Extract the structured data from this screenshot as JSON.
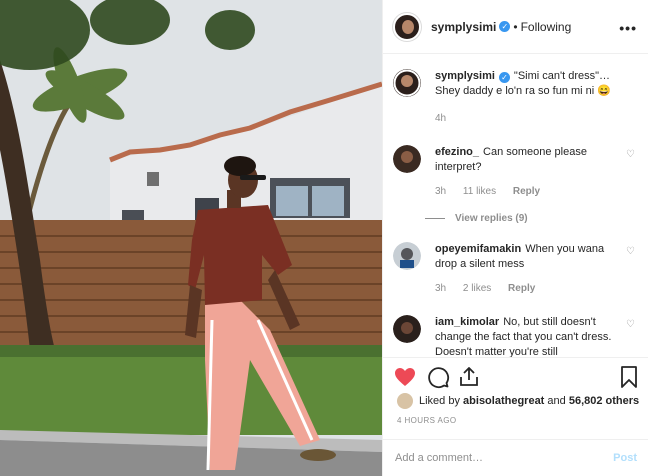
{
  "post": {
    "username": "symplysimi",
    "follow_status": "Following",
    "more": "•••",
    "caption_user": "symplysimi",
    "caption_text": "\"Simi can't dress\"… Shey daddy e lo'n ra so fun mi ni 😄",
    "caption_time": "4h"
  },
  "comments": [
    {
      "user": "efezino_",
      "text": "Can someone please interpret?",
      "time": "3h",
      "likes": "11 likes",
      "reply": "Reply",
      "view_replies": "View replies (9)"
    },
    {
      "user": "opeyemifamakin",
      "text": "When you wana drop a silent mess",
      "time": "3h",
      "likes": "2 likes",
      "reply": "Reply"
    },
    {
      "user": "iam_kimolar",
      "text": "No, but still doesn't change the fact that you can't dress. Doesn't matter you're still"
    }
  ],
  "likes": {
    "liked_by": "Liked by",
    "user": "abisolathegreat",
    "and": "and",
    "others": "56,802 others"
  },
  "timestamp": "4 HOURS AGO",
  "add_comment": {
    "placeholder": "Add a comment…",
    "post_label": "Post"
  },
  "colors": {
    "accent": "#3897f0",
    "heart": "#ed4956"
  },
  "icons": [
    "verified-icon",
    "heart-icon",
    "comment-icon",
    "share-icon",
    "bookmark-icon",
    "more-icon"
  ]
}
